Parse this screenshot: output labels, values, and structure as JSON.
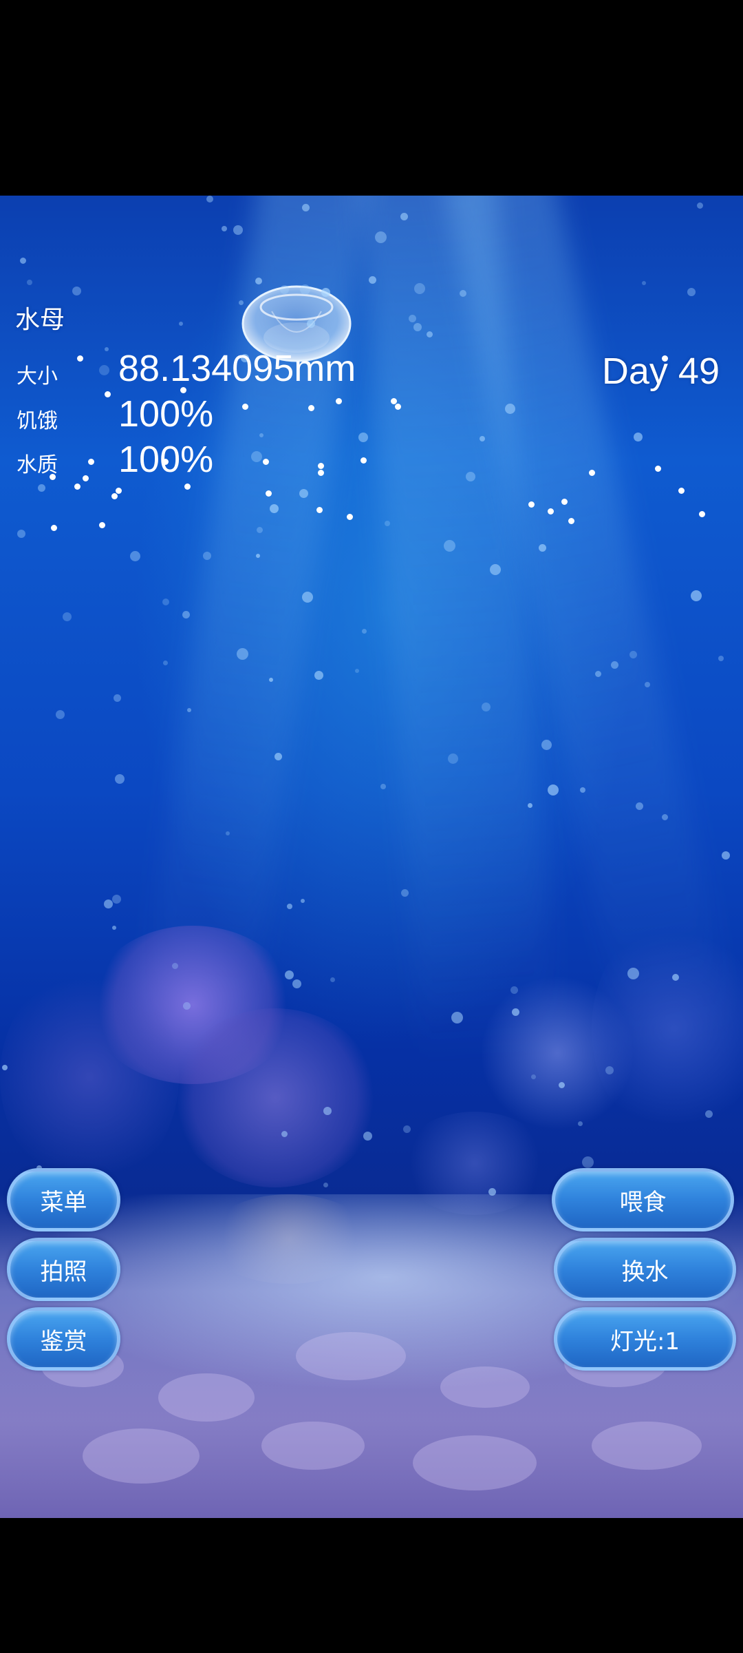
{
  "hud": {
    "species": "水母",
    "stats": [
      {
        "label": "大小",
        "value": "88.134095mm"
      },
      {
        "label": "饥饿",
        "value": "100%"
      },
      {
        "label": "水质",
        "value": "100%"
      }
    ],
    "day": "Day 49"
  },
  "buttons": {
    "left": [
      "菜单",
      "拍照",
      "鉴赏"
    ],
    "right": [
      "喂食",
      "换水",
      "灯光:1"
    ]
  },
  "colors": {
    "water_top": "#0c3fb0",
    "water_mid": "#0b48c2",
    "seabed": "#8c82c8",
    "button": "#2f82dc",
    "button_border": "#aad2ff"
  },
  "icons": {
    "jellyfish": "jellyfish-sprite"
  }
}
